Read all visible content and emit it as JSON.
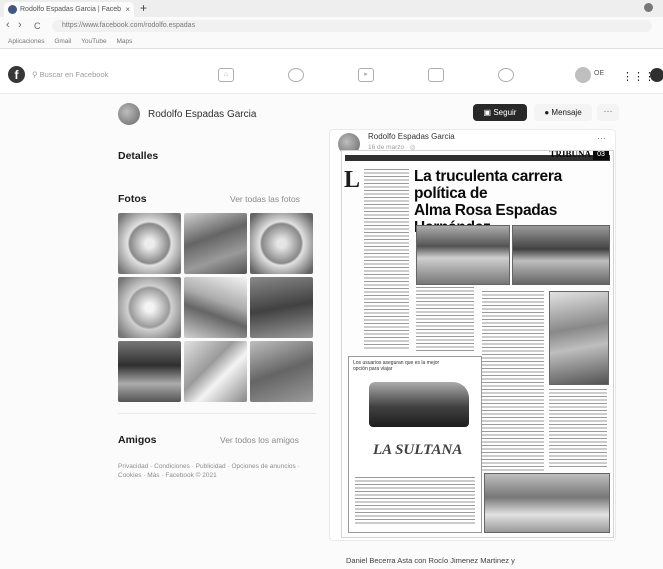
{
  "browser": {
    "tab_title": "Rodolfo Espadas Garcia | Faceb",
    "tab_close": "×",
    "new_tab": "+",
    "back": "‹",
    "forward": "›",
    "reload": "C",
    "url": "https://www.facebook.com/rodolfo.espadas",
    "bookmarks": [
      "Aplicaciones",
      "Gmail",
      "YouTube",
      "Maps"
    ]
  },
  "facebook": {
    "logo": "f",
    "search_placeholder": "Buscar en Facebook",
    "profile_initials": "OE",
    "grid_glyph": "⋮⋮⋮"
  },
  "profile": {
    "name": "Rodolfo Espadas Garcia",
    "follow_label": "Seguir",
    "message_label": "Mensaje",
    "more_label": "···"
  },
  "left": {
    "details_heading": "Detalles",
    "photos_heading": "Fotos",
    "see_all_photos": "Ver todas las fotos",
    "friends_heading": "Amigos",
    "see_all_friends": "Ver todos los amigos",
    "footer": "Privacidad · Condiciones · Publicidad · Opciones de anuncios · Cookies · Más · Facebook © 2021"
  },
  "post": {
    "author": "Rodolfo Espadas Garcia",
    "date": "16 de marzo · ",
    "more": "···",
    "paper": {
      "masthead": "TRIBUNA",
      "page": "03",
      "headline_1": "La truculenta carrera política de",
      "headline_2": "Alma Rosa Espadas Hernández",
      "drop_letter": "L",
      "ad_brand": "LA SULTANA",
      "ad_headline": "Los usuarios aseguran que es la mejor opción para viajar"
    },
    "below_caption": "Daniel Becerra Asta con Rocío Jimenez Martinez y"
  }
}
